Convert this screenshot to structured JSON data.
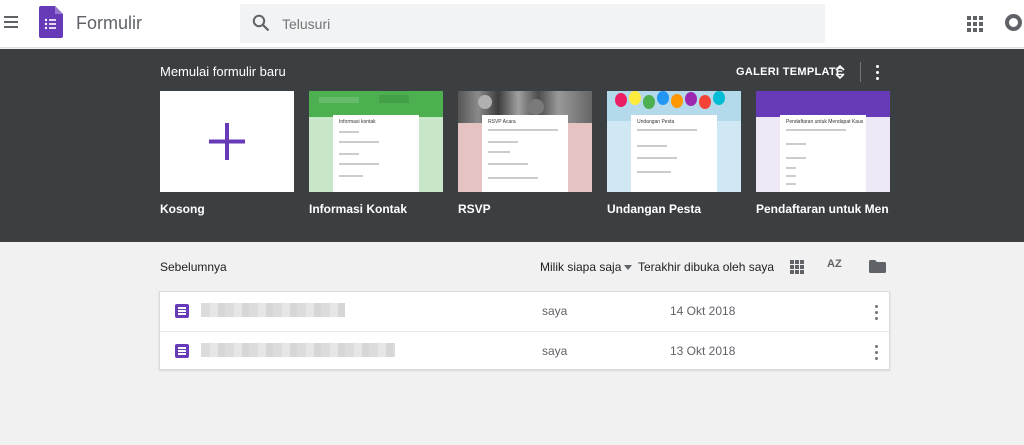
{
  "header": {
    "app_title": "Formulir",
    "search_placeholder": "Telusuri",
    "icons": [
      "menu-icon",
      "forms-logo-icon",
      "search-icon",
      "apps-grid-icon",
      "account-icon"
    ]
  },
  "gallery": {
    "title": "Memulai formulir baru",
    "gallery_link": "GALERI TEMPLATE",
    "templates": [
      {
        "label": "Kosong",
        "thumb_title": ""
      },
      {
        "label": "Informasi Kontak",
        "thumb_title": "Informasi kontak"
      },
      {
        "label": "RSVP",
        "thumb_title": "RSVP Acara"
      },
      {
        "label": "Undangan Pesta",
        "thumb_title": "Undangan Pesta"
      },
      {
        "label": "Pendaftaran untuk Men…",
        "thumb_title": "Pendaftaran untuk Mendapat Kaus"
      }
    ],
    "colors": {
      "background": "#3c3f41",
      "accent": "#673ab7"
    }
  },
  "previous": {
    "title": "Sebelumnya",
    "owner_filter": "Milik siapa saja",
    "sort_label": "Terakhir dibuka oleh saya",
    "az_label": "AZ",
    "rows": [
      {
        "owner": "saya",
        "date": "14 Okt 2018"
      },
      {
        "owner": "saya",
        "date": "13 Okt 2018"
      }
    ]
  }
}
